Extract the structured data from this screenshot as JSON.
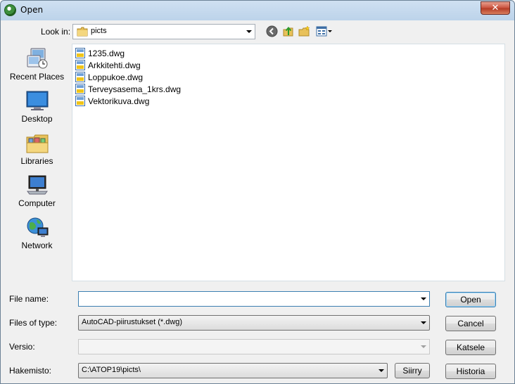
{
  "window": {
    "title": "Open",
    "close_symbol": "✕"
  },
  "lookin": {
    "label": "Look in:",
    "value": "picts"
  },
  "places": [
    {
      "label": "Recent Places",
      "icon": "recent-places-icon"
    },
    {
      "label": "Desktop",
      "icon": "desktop-icon"
    },
    {
      "label": "Libraries",
      "icon": "libraries-icon"
    },
    {
      "label": "Computer",
      "icon": "computer-icon"
    },
    {
      "label": "Network",
      "icon": "network-icon"
    }
  ],
  "files": [
    {
      "name": "1235.dwg"
    },
    {
      "name": "Arkkitehti.dwg"
    },
    {
      "name": "Loppukoe.dwg"
    },
    {
      "name": "Terveysasema_1krs.dwg"
    },
    {
      "name": "Vektorikuva.dwg"
    }
  ],
  "form": {
    "filename_label": "File name:",
    "filename_value": "",
    "filetype_label": "Files of type:",
    "filetype_value": "AutoCAD-piirustukset (*.dwg)",
    "versio_label": "Versio:",
    "versio_value": "",
    "hakemisto_label": "Hakemisto:",
    "hakemisto_value": "C:\\ATOP19\\picts\\"
  },
  "buttons": {
    "open": "Open",
    "cancel": "Cancel",
    "katsele": "Katsele",
    "siirry": "Siirry",
    "historia": "Historia"
  },
  "colors": {
    "accent": "#3c7fb1",
    "list_background": "#ffffff",
    "dialog_background": "#f0f0f0"
  }
}
